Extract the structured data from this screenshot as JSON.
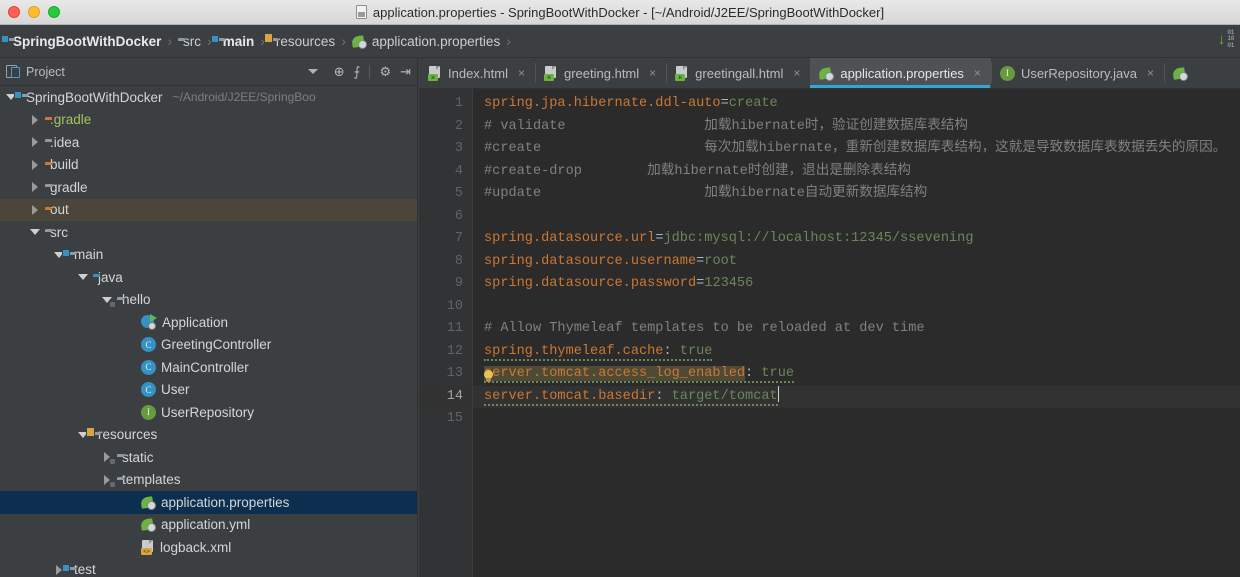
{
  "window": {
    "title": "application.properties - SpringBootWithDocker - [~/Android/J2EE/SpringBootWithDocker]",
    "traffic_lights": [
      "close",
      "minimize",
      "zoom"
    ]
  },
  "breadcrumbs": [
    {
      "label": "SpringBootWithDocker",
      "icon": "module-folder-icon",
      "bold": true
    },
    {
      "label": "src",
      "icon": "folder-icon",
      "bold": false
    },
    {
      "label": "main",
      "icon": "source-folder-icon",
      "bold": true
    },
    {
      "label": "resources",
      "icon": "resources-folder-icon",
      "bold": false
    },
    {
      "label": "application.properties",
      "icon": "spring-properties-icon",
      "bold": false
    }
  ],
  "breadcrumb_separator": "›",
  "toolbar_right": {
    "update_project_icon": "vcs-update-icon",
    "arrow_glyph": "↓",
    "bits": [
      "01",
      "10",
      "01"
    ],
    "accent_green": "#6cb33f"
  },
  "project_panel": {
    "title": "Project",
    "tools": [
      {
        "name": "locate-icon",
        "glyph": "⊕"
      },
      {
        "name": "collapse-all-icon",
        "glyph": "⨍"
      },
      {
        "name": "settings-gear-icon",
        "glyph": "⚙"
      },
      {
        "name": "hide-panel-icon",
        "glyph": "⇥"
      }
    ],
    "tree": [
      {
        "label": "SpringBootWithDocker",
        "sub": "~/Android/J2EE/SpringBoo",
        "indent": 0,
        "arrow": "open",
        "icon": "module-folder-icon",
        "state": "normal"
      },
      {
        "label": ".gradle",
        "sub": "",
        "indent": 1,
        "arrow": "closed",
        "icon": "folder-orange-icon",
        "state": "excluded",
        "color": "green"
      },
      {
        "label": ".idea",
        "sub": "",
        "indent": 1,
        "arrow": "closed",
        "icon": "folder-icon",
        "state": "normal"
      },
      {
        "label": "build",
        "sub": "",
        "indent": 1,
        "arrow": "closed",
        "icon": "folder-orange-icon",
        "state": "normal"
      },
      {
        "label": "gradle",
        "sub": "",
        "indent": 1,
        "arrow": "closed",
        "icon": "folder-icon",
        "state": "normal"
      },
      {
        "label": "out",
        "sub": "",
        "indent": 1,
        "arrow": "closed",
        "icon": "folder-orange-icon",
        "state": "hovered"
      },
      {
        "label": "src",
        "sub": "",
        "indent": 1,
        "arrow": "open",
        "icon": "folder-icon",
        "state": "normal"
      },
      {
        "label": "main",
        "sub": "",
        "indent": 2,
        "arrow": "open",
        "icon": "source-folder-icon",
        "state": "normal"
      },
      {
        "label": "java",
        "sub": "",
        "indent": 3,
        "arrow": "open",
        "icon": "folder-blue-icon",
        "state": "normal"
      },
      {
        "label": "hello",
        "sub": "",
        "indent": 4,
        "arrow": "open",
        "icon": "package-folder-icon",
        "state": "normal"
      },
      {
        "label": "Application",
        "sub": "",
        "indent": 5,
        "arrow": "none",
        "icon": "spring-boot-app-icon",
        "state": "normal"
      },
      {
        "label": "GreetingController",
        "sub": "",
        "indent": 5,
        "arrow": "none",
        "icon": "java-class-icon",
        "state": "normal"
      },
      {
        "label": "MainController",
        "sub": "",
        "indent": 5,
        "arrow": "none",
        "icon": "java-class-icon",
        "state": "normal"
      },
      {
        "label": "User",
        "sub": "",
        "indent": 5,
        "arrow": "none",
        "icon": "java-class-icon",
        "state": "normal"
      },
      {
        "label": "UserRepository",
        "sub": "",
        "indent": 5,
        "arrow": "none",
        "icon": "java-interface-icon",
        "state": "normal"
      },
      {
        "label": "resources",
        "sub": "",
        "indent": 3,
        "arrow": "open",
        "icon": "resources-folder-icon",
        "state": "normal"
      },
      {
        "label": "static",
        "sub": "",
        "indent": 4,
        "arrow": "closed",
        "icon": "package-folder-icon",
        "state": "normal"
      },
      {
        "label": "templates",
        "sub": "",
        "indent": 4,
        "arrow": "closed",
        "icon": "package-folder-icon",
        "state": "normal"
      },
      {
        "label": "application.properties",
        "sub": "",
        "indent": 5,
        "arrow": "none",
        "icon": "spring-properties-icon",
        "state": "selected"
      },
      {
        "label": "application.yml",
        "sub": "",
        "indent": 5,
        "arrow": "none",
        "icon": "spring-properties-icon",
        "state": "normal"
      },
      {
        "label": "logback.xml",
        "sub": "",
        "indent": 5,
        "arrow": "none",
        "icon": "xml-file-icon",
        "state": "normal"
      },
      {
        "label": "test",
        "sub": "",
        "indent": 2,
        "arrow": "closed",
        "icon": "test-folder-icon",
        "state": "normal"
      }
    ]
  },
  "editor": {
    "tabs": [
      {
        "label": "Index.html",
        "icon": "html-file-icon",
        "active": false,
        "close": "×"
      },
      {
        "label": "greeting.html",
        "icon": "html-file-icon",
        "active": false,
        "close": "×"
      },
      {
        "label": "greetingall.html",
        "icon": "html-file-icon",
        "active": false,
        "close": "×"
      },
      {
        "label": "application.properties",
        "icon": "spring-properties-icon",
        "active": true,
        "close": "×"
      },
      {
        "label": "UserRepository.java",
        "icon": "java-interface-icon",
        "active": false,
        "close": "×"
      }
    ],
    "line_numbers": [
      "1",
      "2",
      "3",
      "4",
      "5",
      "6",
      "7",
      "8",
      "9",
      "10",
      "11",
      "12",
      "13",
      "14",
      "15"
    ],
    "current_line": 14,
    "lines": [
      {
        "n": 1,
        "key": "spring.jpa.hibernate.ddl-auto",
        "sep": "=",
        "value": "create",
        "type": "prop"
      },
      {
        "n": 2,
        "text": "# validate                 加载hibernate时，验证创建数据库表结构",
        "type": "comment"
      },
      {
        "n": 3,
        "text": "#create                    每次加载hibernate，重新创建数据库表结构，这就是导致数据库表数据丢失的原因。",
        "type": "comment"
      },
      {
        "n": 4,
        "text": "#create-drop        加载hibernate时创建，退出是删除表结构",
        "type": "comment"
      },
      {
        "n": 5,
        "text": "#update                    加载hibernate自动更新数据库结构",
        "type": "comment"
      },
      {
        "n": 6,
        "text": "",
        "type": "blank"
      },
      {
        "n": 7,
        "key": "spring.datasource.url",
        "sep": "=",
        "value": "jdbc:mysql://localhost:12345/ssevening",
        "type": "prop",
        "spell_tail": "ssevening"
      },
      {
        "n": 8,
        "key": "spring.datasource.username",
        "sep": "=",
        "value": "root",
        "type": "prop"
      },
      {
        "n": 9,
        "key": "spring.datasource.password",
        "sep": "=",
        "value": "123456",
        "type": "prop"
      },
      {
        "n": 10,
        "text": "",
        "type": "blank"
      },
      {
        "n": 11,
        "text": "# Allow Thymeleaf templates to be reloaded at dev time",
        "type": "comment"
      },
      {
        "n": 12,
        "key": "spring.thymeleaf.cache",
        "sep": ": ",
        "value": "true",
        "type": "prop"
      },
      {
        "n": 13,
        "key": "server.tomcat.access_log_enabled",
        "sep": ": ",
        "value": "true",
        "type": "prop",
        "highlight": true,
        "bulb": true
      },
      {
        "n": 14,
        "key": "server.tomcat.basedir",
        "sep": ": ",
        "value": "target/tomcat",
        "type": "prop",
        "caret": true
      },
      {
        "n": 15,
        "text": "",
        "type": "blank"
      }
    ]
  },
  "colors": {
    "editor_bg": "#2b2b2b",
    "panel_bg": "#3c3f41",
    "gutter_bg": "#313335",
    "key_orange": "#cc7832",
    "value_green": "#6a8759",
    "comment_gray": "#808080",
    "selection_blue": "#0d2f4f",
    "active_tab_underline": "#2fa8d4",
    "highlight_tan": "#4e4a36"
  }
}
